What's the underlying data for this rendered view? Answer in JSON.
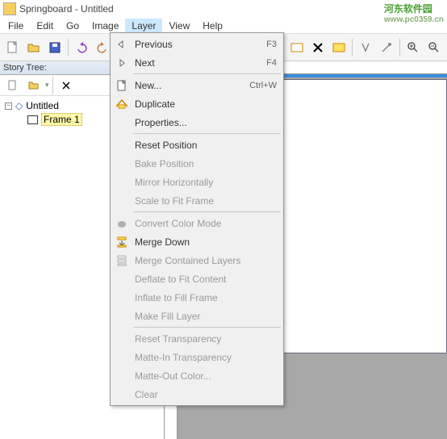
{
  "window": {
    "title": "Springboard - Untitled"
  },
  "menubar": [
    "File",
    "Edit",
    "Go",
    "Image",
    "Layer",
    "View",
    "Help"
  ],
  "menubar_active_index": 4,
  "sidebar": {
    "panel_title": "Story Tree:",
    "root_label": "Untitled",
    "frame_label": "Frame 1"
  },
  "context_menu": [
    {
      "type": "item",
      "label": "Previous",
      "shortcut": "F3",
      "icon": "left-arrow",
      "disabled": false
    },
    {
      "type": "item",
      "label": "Next",
      "shortcut": "F4",
      "icon": "right-arrow",
      "disabled": false
    },
    {
      "type": "sep"
    },
    {
      "type": "item",
      "label": "New...",
      "shortcut": "Ctrl+W",
      "icon": "new-doc",
      "disabled": false
    },
    {
      "type": "item",
      "label": "Duplicate",
      "icon": "duplicate",
      "disabled": false
    },
    {
      "type": "item",
      "label": "Properties...",
      "disabled": false
    },
    {
      "type": "sep"
    },
    {
      "type": "item",
      "label": "Reset Position",
      "disabled": false
    },
    {
      "type": "item",
      "label": "Bake Position",
      "disabled": true
    },
    {
      "type": "item",
      "label": "Mirror Horizontally",
      "disabled": true
    },
    {
      "type": "item",
      "label": "Scale to Fit Frame",
      "disabled": true
    },
    {
      "type": "sep"
    },
    {
      "type": "item",
      "label": "Convert Color Mode",
      "icon": "blob",
      "disabled": true
    },
    {
      "type": "item",
      "label": "Merge Down",
      "icon": "merge-down",
      "disabled": false
    },
    {
      "type": "item",
      "label": "Merge Contained Layers",
      "icon": "merge-contained",
      "disabled": true
    },
    {
      "type": "item",
      "label": "Deflate to Fit Content",
      "disabled": true
    },
    {
      "type": "item",
      "label": "Inflate to Fill Frame",
      "disabled": true
    },
    {
      "type": "item",
      "label": "Make Fill Layer",
      "disabled": true
    },
    {
      "type": "sep"
    },
    {
      "type": "item",
      "label": "Reset Transparency",
      "disabled": true
    },
    {
      "type": "item",
      "label": "Matte-In Transparency",
      "disabled": true
    },
    {
      "type": "item",
      "label": "Matte-Out Color...",
      "disabled": true
    },
    {
      "type": "item",
      "label": "Clear",
      "disabled": true
    }
  ],
  "watermark": {
    "line1": "河东软件园",
    "line2": "www.pc0359.cn"
  }
}
